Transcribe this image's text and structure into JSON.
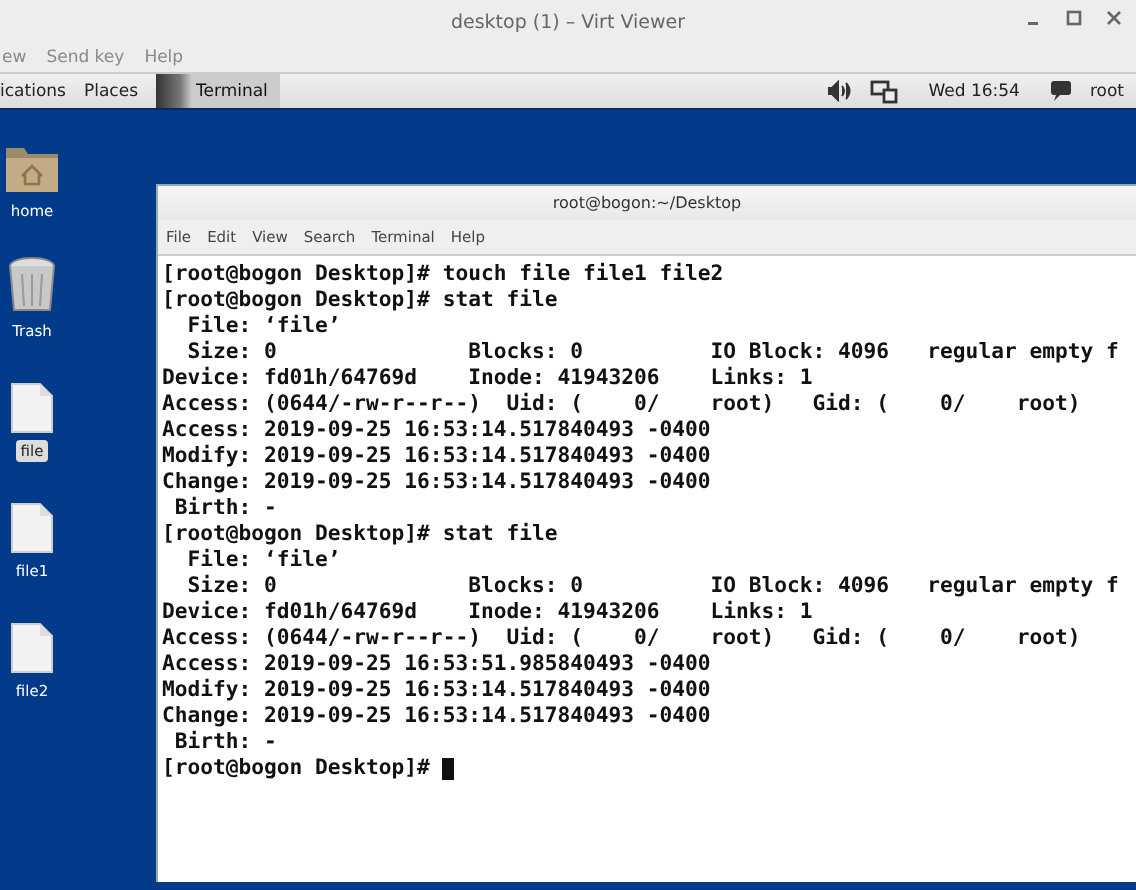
{
  "window": {
    "title": "desktop (1) – Virt Viewer"
  },
  "menu": [
    "ew",
    "Send key",
    "Help"
  ],
  "panel": {
    "applications": "ications",
    "places": "Places",
    "taskbar": [
      {
        "label": "Terminal",
        "selected": true
      }
    ],
    "clock": "Wed 16:54",
    "user": "root"
  },
  "desktop_icons": [
    {
      "kind": "home",
      "label": "home",
      "selected": false
    },
    {
      "kind": "trash",
      "label": "Trash",
      "selected": false
    },
    {
      "kind": "file",
      "label": "file",
      "selected": true
    },
    {
      "kind": "file",
      "label": "file1",
      "selected": false
    },
    {
      "kind": "file",
      "label": "file2",
      "selected": false
    }
  ],
  "terminal": {
    "title": "root@bogon:~/Desktop",
    "menu": [
      "File",
      "Edit",
      "View",
      "Search",
      "Terminal",
      "Help"
    ],
    "lines": [
      "[root@bogon Desktop]# touch file file1 file2",
      "[root@bogon Desktop]# stat file",
      "  File: ‘file’",
      "  Size: 0               Blocks: 0          IO Block: 4096   regular empty f",
      "Device: fd01h/64769d    Inode: 41943206    Links: 1",
      "Access: (0644/-rw-r--r--)  Uid: (    0/    root)   Gid: (    0/    root)",
      "Access: 2019-09-25 16:53:14.517840493 -0400",
      "Modify: 2019-09-25 16:53:14.517840493 -0400",
      "Change: 2019-09-25 16:53:14.517840493 -0400",
      " Birth: -",
      "[root@bogon Desktop]# stat file",
      "  File: ‘file’",
      "  Size: 0               Blocks: 0          IO Block: 4096   regular empty f",
      "Device: fd01h/64769d    Inode: 41943206    Links: 1",
      "Access: (0644/-rw-r--r--)  Uid: (    0/    root)   Gid: (    0/    root)",
      "Access: 2019-09-25 16:53:51.985840493 -0400",
      "Modify: 2019-09-25 16:53:14.517840493 -0400",
      "Change: 2019-09-25 16:53:14.517840493 -0400",
      " Birth: -",
      "[root@bogon Desktop]# "
    ],
    "cursor": true
  }
}
